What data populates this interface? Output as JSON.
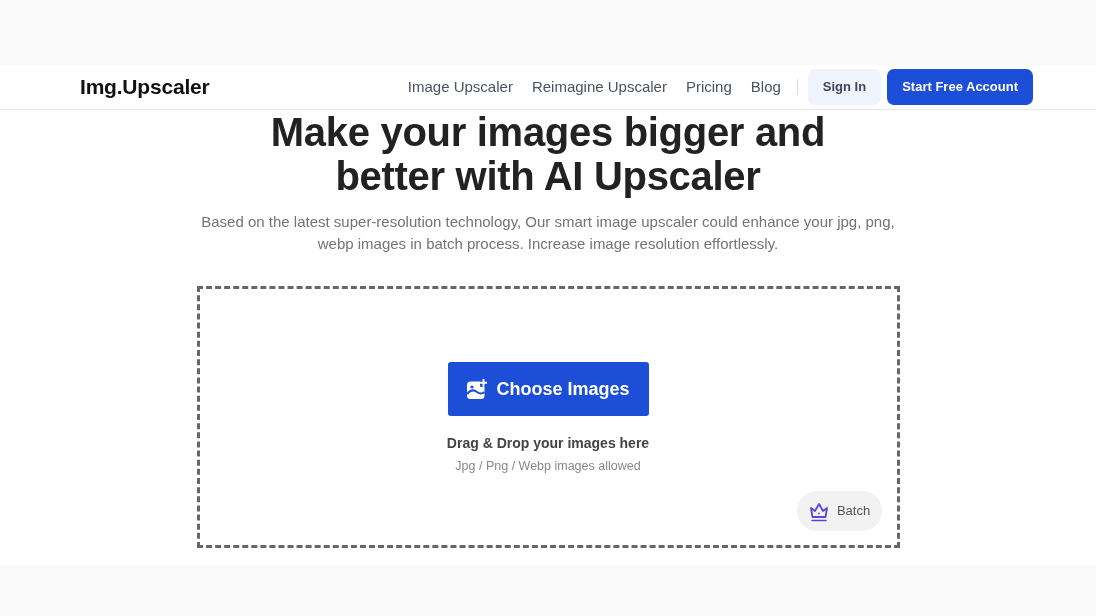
{
  "header": {
    "logo": "Img.Upscaler",
    "nav_links": [
      "Image Upscaler",
      "Reimagine Upscaler",
      "Pricing",
      "Blog"
    ],
    "sign_in": "Sign In",
    "cta": "Start Free Account"
  },
  "hero": {
    "title": "Make your images bigger and better with AI Upscaler",
    "description": "Based on the latest super-resolution technology, Our smart image upscaler could enhance your jpg, png, webp images in batch process. Increase image resolution effortlessly."
  },
  "upload": {
    "button": "Choose Images",
    "drop_text": "Drag & Drop your images here",
    "formats": "Jpg / Png / Webp images allowed",
    "batch_button": "Batch"
  }
}
